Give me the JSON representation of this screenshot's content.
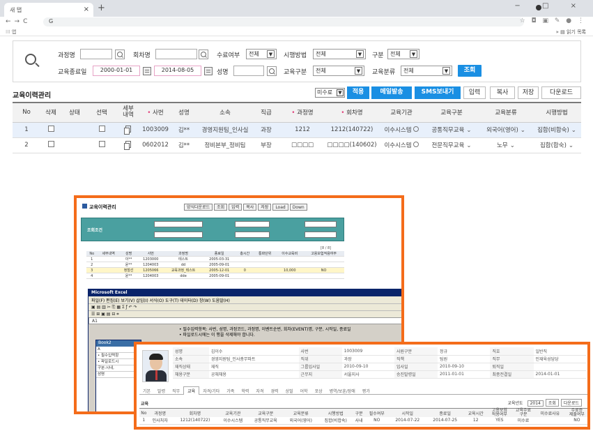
{
  "browser": {
    "tab_title": "새 탭",
    "url": "G",
    "bookmarks_apps": "앱",
    "bookmarks_other": "읽기 목록",
    "window_controls": "− □ ×"
  },
  "search": {
    "course_name_label": "과정명",
    "session_name_label": "회차명",
    "completion_label": "수료여부",
    "completion_value": "전체",
    "method_label": "시행방법",
    "method_value": "전체",
    "category_label": "구분",
    "category_value": "전체",
    "end_date_label": "교육종료일",
    "date_from": "2000-01-01",
    "date_to": "2014-08-05",
    "name_label": "성명",
    "edu_type_label": "교육구분",
    "edu_type_value": "전체",
    "edu_class_label": "교육분류",
    "edu_class_value": "전체",
    "search_button": "조회"
  },
  "list": {
    "title": "교육이력관리",
    "status_select": "미수료",
    "apply_button": "적용",
    "mail_button": "메일발송",
    "sms_button": "SMS보내기",
    "input_button": "입력",
    "copy_button": "복사",
    "save_button": "저장",
    "download_button": "다운로드",
    "columns": [
      "No",
      "삭제",
      "상태",
      "선택",
      "세부\n내역",
      "사번",
      "성명",
      "소속",
      "직급",
      "과정명",
      "회차명",
      "교육기관",
      "교육구분",
      "교육분류",
      "시행방법"
    ],
    "rows": [
      {
        "no": "1",
        "emp_no": "1003009",
        "name": "김**",
        "dept": "경영지원팀_인사실",
        "rank": "과장",
        "course": "1212",
        "session": "1212(140722)",
        "institution": "이수시스템",
        "edu_type": "공통직무교육",
        "edu_class": "외국어(영어)",
        "method": "집합(비합숙)"
      },
      {
        "no": "2",
        "emp_no": "0602012",
        "name": "김**",
        "dept": "정비본부_정비팀",
        "rank": "부장",
        "course": "□□□□",
        "session": "□□□□(140602)",
        "institution": "이수시스템",
        "edu_type": "전문직무교육",
        "edu_class": "노무",
        "method": "집합(합숙)"
      }
    ]
  },
  "overlay1": {
    "title": "교육이력관리",
    "buttons": [
      "양식다운로드",
      "조회",
      "입력",
      "복사",
      "저장",
      "Load",
      "Down"
    ],
    "cond_label": "조회조건",
    "count": "[8 / 8]",
    "grid_cols": [
      "No",
      "세부내역",
      "성명",
      "사번",
      "과정명",
      "종료일",
      "총시간",
      "통화단위",
      "이수교육비",
      "고용보험적용여부"
    ],
    "grid_rows": [
      [
        "1",
        "",
        "이**",
        "1203000",
        "테스트",
        "2005-03-31",
        "",
        "",
        "",
        ""
      ],
      [
        "2",
        "",
        "윤**",
        "1204003",
        "dd",
        "2005-09-01",
        "",
        "",
        "",
        ""
      ],
      [
        "3",
        "",
        "정철선",
        "1205066",
        "교육과정_테스트",
        "2005-12-01",
        "0",
        "",
        "10,000",
        "NO"
      ],
      [
        "4",
        "",
        "윤**",
        "1204003",
        "dde",
        "2005-09-01",
        "",
        "",
        "",
        ""
      ]
    ],
    "excel_title": "Microsoft Excel",
    "excel_menu": "파일(F) 편집(E) 보기(V) 삽입(I) 서식(O) 도구(T) 데이터(D) 창(W) 도움말(H)",
    "excel_name_box": "A1",
    "book_title": "Book2",
    "note_line1": "• 필수입력항목: 사번, 성명, 과정코드, 과정명, 이벤트순번, 회차(EVENT)명, 구분, 시작일, 종료일",
    "note_line2": "• 파일로드시에는 이 행을 삭제해야 합니다.",
    "book_cells": [
      "A",
      "• 필수입력항",
      "• 파일로드시",
      "구분:시내,",
      "성명"
    ]
  },
  "overlay2": {
    "info_rows": [
      [
        "성명",
        "김이수",
        "사번",
        "1003009",
        "사원구분",
        "정규",
        "직호",
        "일반직"
      ],
      [
        "소속",
        "경영지원팀_인사총무파트",
        "직위",
        "과장",
        "직책",
        "팀원",
        "직무",
        "인재육성담당"
      ],
      [
        "재직상태",
        "재직",
        "그룹입사일",
        "2010-09-10",
        "입사일",
        "2010-09-10",
        "퇴직일",
        ""
      ],
      [
        "채용구분",
        "공채채용",
        "근무지",
        "서울지사",
        "승진발령일",
        "2011-01-01",
        "최종전결일",
        "2014-01-01"
      ]
    ],
    "tabs": [
      "기본",
      "발령",
      "직무",
      "교육",
      "자격/기타",
      "가족",
      "학력",
      "자격",
      "경력",
      "상벌",
      "어학",
      "포상",
      "병역/보훈/장애",
      "평가"
    ],
    "active_tab": "교육",
    "edu_title": "교육",
    "status_label": "교육년도",
    "status_value": "2014",
    "search_btn": "조회",
    "download_btn": "다운로드",
    "cols": [
      "No",
      "과정명",
      "회차명",
      "교육기관",
      "교육구분",
      "교육분류",
      "시행방법",
      "구분",
      "필수여부",
      "시작일",
      "종료일",
      "교육시간",
      "고용보험\n적용여부",
      "교육수료\n구분",
      "미수료사유",
      "수료증\n제출여부"
    ],
    "row": [
      "1",
      "인사처자",
      "1212(140722)",
      "이수시스템",
      "공통직무교육",
      "외국어(영어)",
      "집합(비합숙)",
      "사내",
      "NO",
      "2014-07-22",
      "2014-07-25",
      "12",
      "YES",
      "미수료",
      "",
      "NO"
    ]
  }
}
